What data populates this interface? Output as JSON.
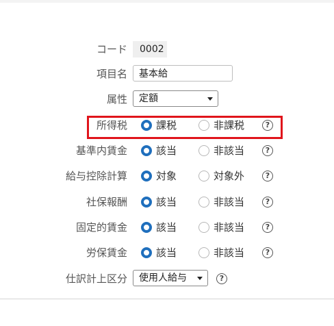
{
  "form": {
    "code": {
      "label": "コード",
      "value": "0002"
    },
    "item_name": {
      "label": "項目名",
      "value": "基本給"
    },
    "attribute": {
      "label": "属性",
      "selected": "定額"
    },
    "income_tax": {
      "label": "所得税",
      "option_on": "課税",
      "option_off": "非課税",
      "selected": "課税"
    },
    "standard_wage": {
      "label": "基準内賃金",
      "option_on": "該当",
      "option_off": "非該当",
      "selected": "該当"
    },
    "salary_deduction": {
      "label": "給与控除計算",
      "option_on": "対象",
      "option_off": "対象外",
      "selected": "対象"
    },
    "social_insurance": {
      "label": "社保報酬",
      "option_on": "該当",
      "option_off": "非該当",
      "selected": "該当"
    },
    "fixed_wage": {
      "label": "固定的賃金",
      "option_on": "該当",
      "option_off": "非該当",
      "selected": "該当"
    },
    "labor_insurance": {
      "label": "労保賃金",
      "option_on": "該当",
      "option_off": "非該当",
      "selected": "該当"
    },
    "journal_category": {
      "label": "仕訳計上区分",
      "selected": "使用人給与"
    }
  },
  "help_glyph": "?",
  "highlight_color": "#e0141b",
  "accent_color": "#1f6fbd"
}
